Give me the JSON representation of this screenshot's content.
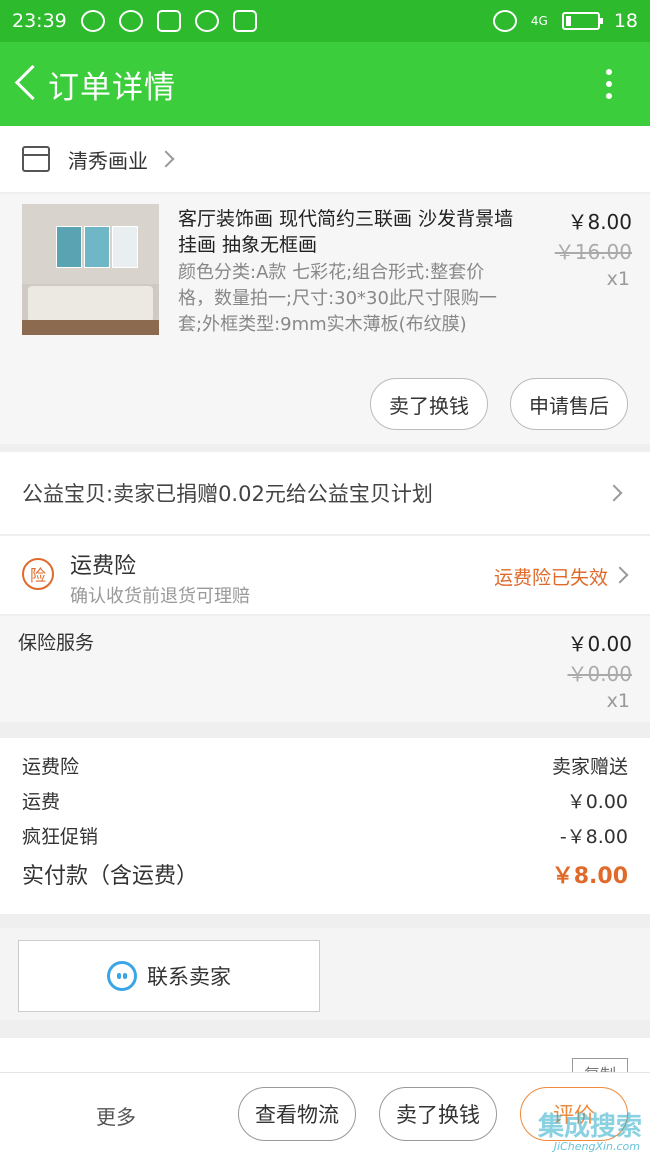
{
  "status_bar": {
    "time": "23:39",
    "battery_level": 18,
    "battery_label": "18",
    "network_label": "4G"
  },
  "header": {
    "title": "订单详情"
  },
  "shop": {
    "name": "清秀画业"
  },
  "product": {
    "title": "客厅装饰画 现代简约三联画 沙发背景墙挂画 抽象无框画",
    "spec": "颜色分类:A款 七彩花;组合形式:整套价格，数量拍一;尺寸:30*30此尺寸限购一套;外框类型:9mm实木薄板(布纹膜)",
    "price": "￥8.00",
    "original_price": "￥16.00",
    "quantity": "x1",
    "buttons": {
      "sell_label": "卖了换钱",
      "refund_label": "申请售后"
    }
  },
  "charity": {
    "text": "公益宝贝:卖家已捐赠0.02元给公益宝贝计划"
  },
  "shipping_insurance": {
    "badge": "险",
    "title": "运费险",
    "subtitle": "确认收货前退货可理赔",
    "status": "运费险已失效",
    "status_color": "#e06a2a"
  },
  "insurance_service": {
    "label": "保险服务",
    "price": "￥0.00",
    "original_price": "￥0.00",
    "quantity": "x1"
  },
  "summary": {
    "rows": [
      {
        "label": "运费险",
        "value": "卖家赠送"
      },
      {
        "label": "运费",
        "value": "￥0.00"
      },
      {
        "label": "疯狂促销",
        "value": "-￥8.00"
      }
    ],
    "total_label": "实付款（含运费）",
    "total_value": "￥8.00",
    "accent_color": "#e06a2a"
  },
  "contact": {
    "label": "联系卖家"
  },
  "order_info": {
    "copy_label": "复制"
  },
  "bottom_bar": {
    "more_label": "更多",
    "logistics_label": "查看物流",
    "sell_label": "卖了换钱",
    "review_label": "评价"
  },
  "watermark": {
    "text": "集成搜索",
    "sub": "JiChengXin.com"
  }
}
